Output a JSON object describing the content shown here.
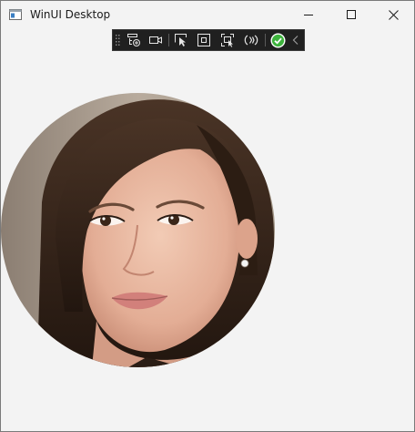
{
  "window": {
    "title": "WinUI Desktop"
  },
  "caption_buttons": {
    "minimize_icon": "minimize-icon",
    "maximize_icon": "maximize-icon",
    "close_icon": "close-icon"
  },
  "debug_toolbar": {
    "tools": [
      "drag-handle-icon",
      "select-element-icon",
      "record-video-icon",
      "select-pointer-icon",
      "display-layout-adorners-icon",
      "track-focused-element-icon",
      "hot-reload-icon",
      "check-status-icon",
      "collapse-chevron-icon"
    ]
  },
  "content": {
    "image": "circular-portrait-photo"
  },
  "colors": {
    "window_background": "#f3f3f3",
    "toolbar_background": "#202020",
    "status_ok": "#3db33d"
  }
}
